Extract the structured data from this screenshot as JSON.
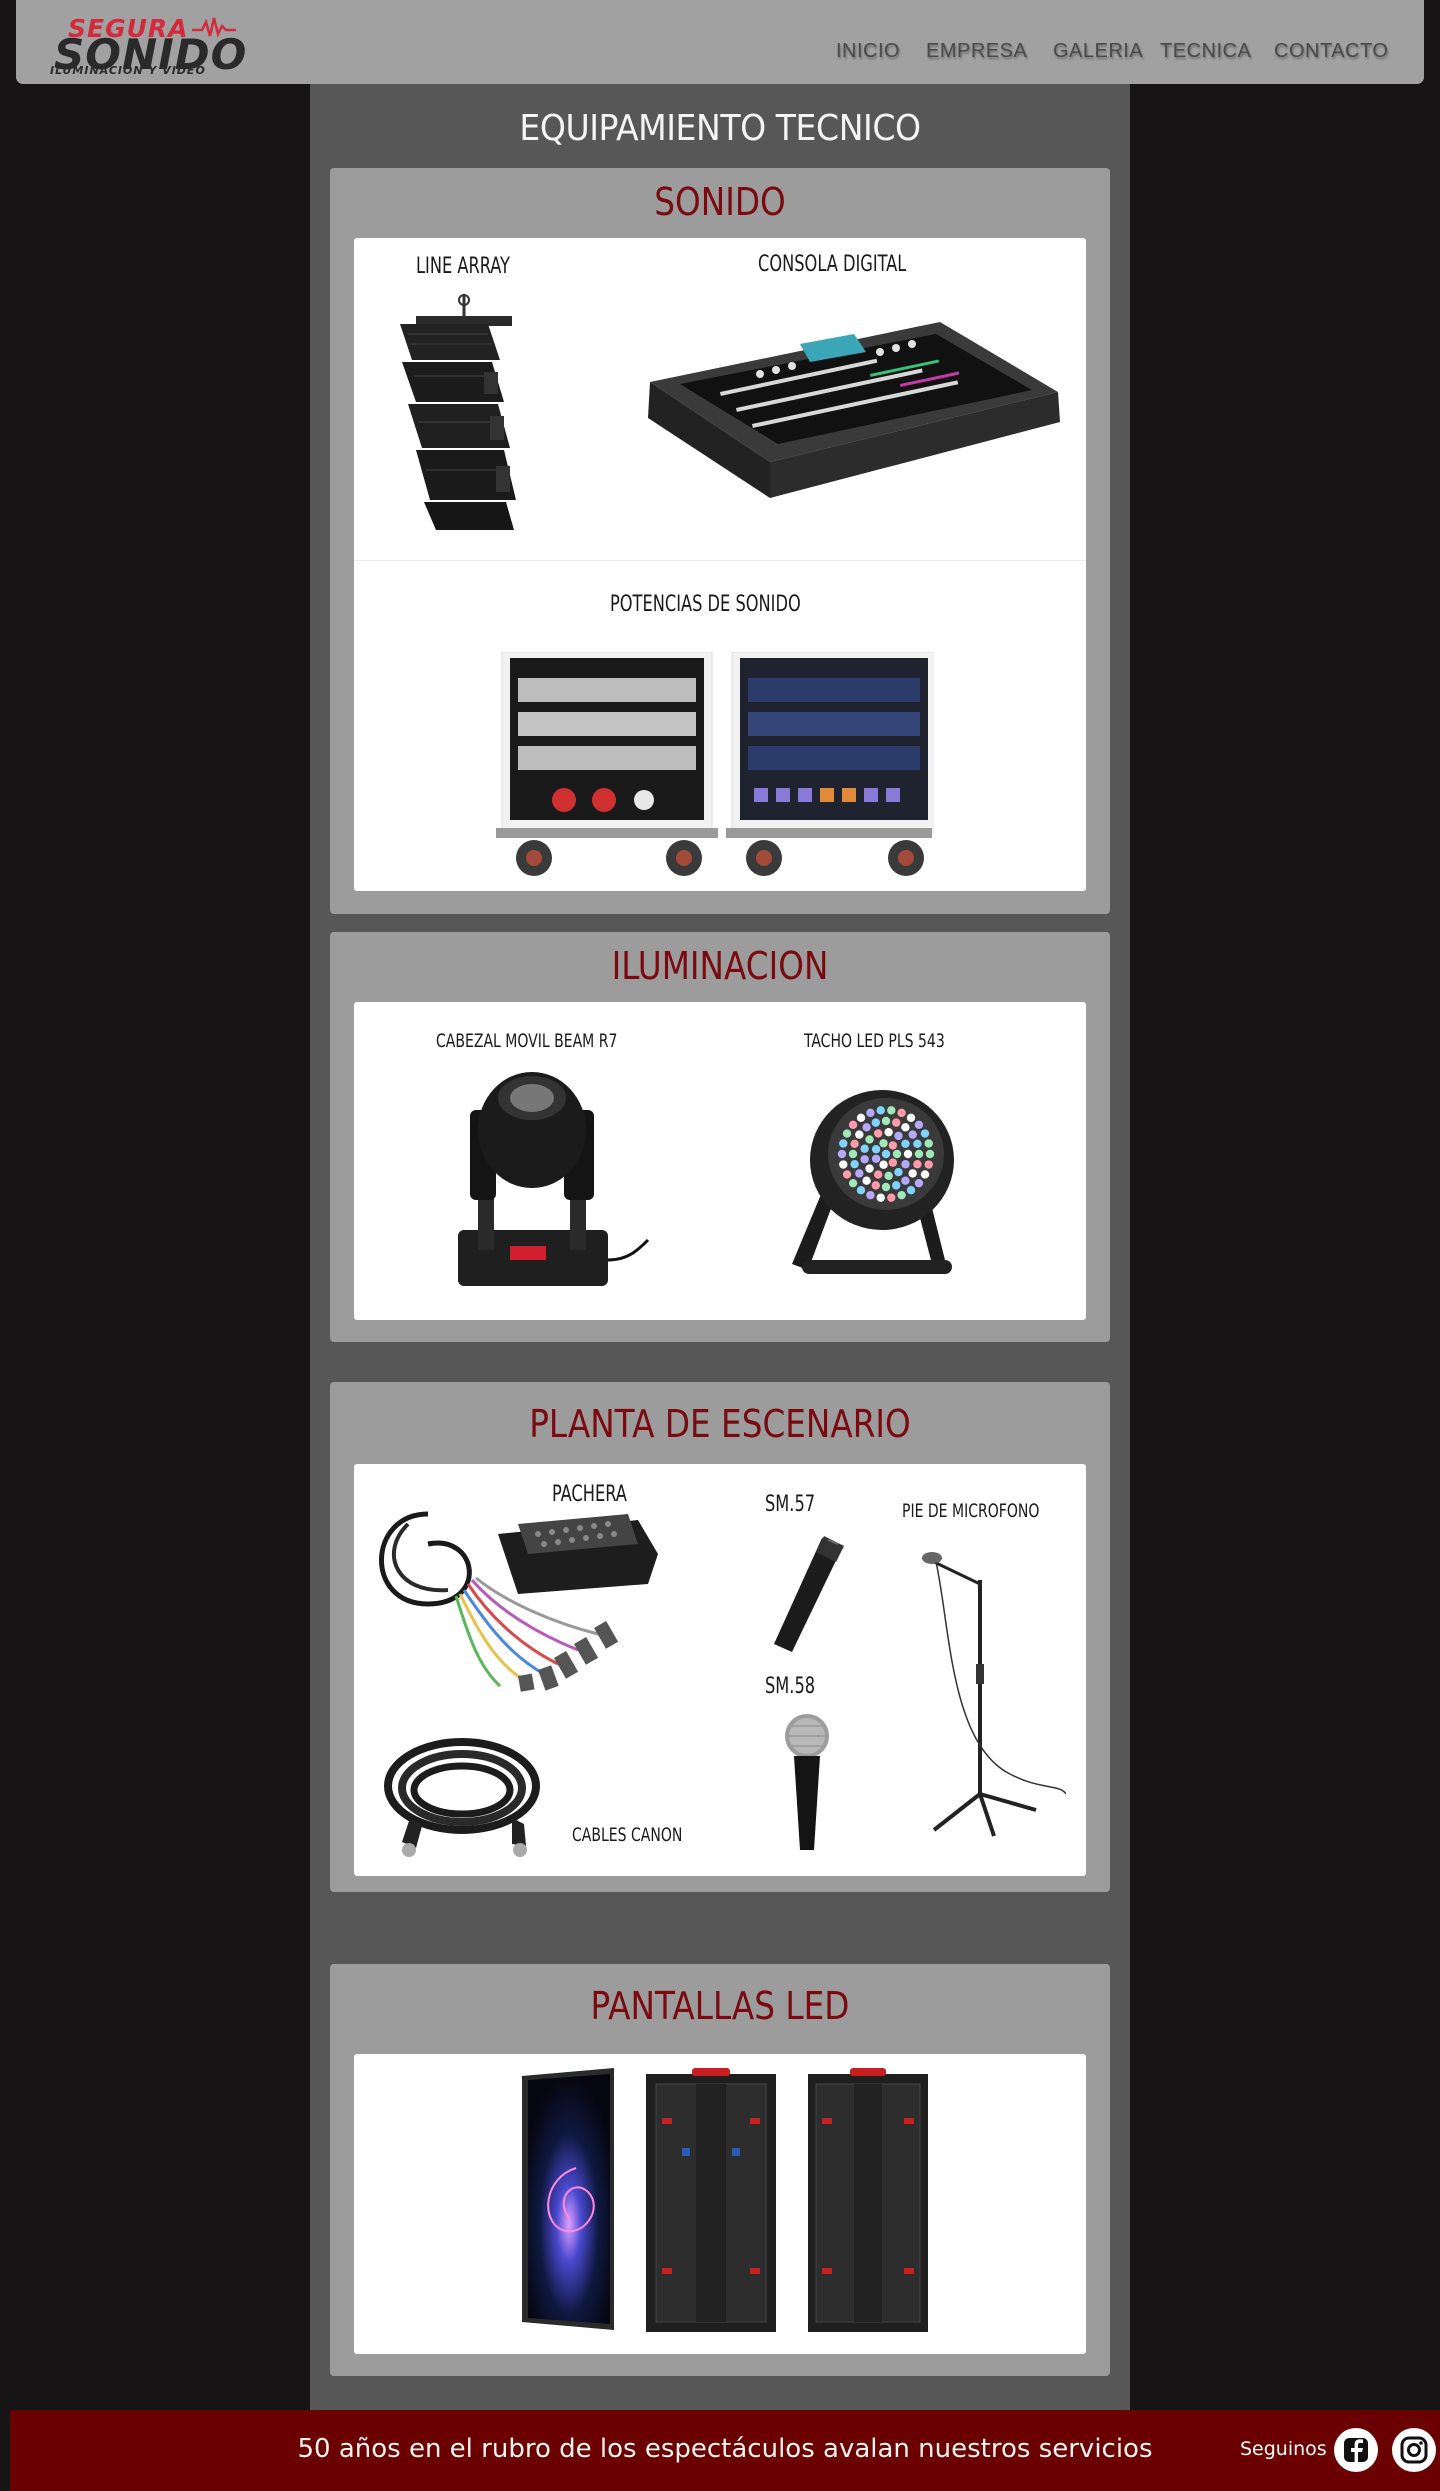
{
  "brand": {
    "logo_line1": "SEGURA",
    "logo_line2": "SONIDO",
    "logo_line3": "ILUMINACION Y VIDEO",
    "colors": {
      "accent": "#7a0a10",
      "logo_red": "#d42a3c",
      "footer": "#6b0000",
      "header": "#a1a1a1",
      "panel": "#9c9c9c",
      "column": "#575757",
      "background": "#161415"
    }
  },
  "nav": {
    "items": [
      {
        "label": "INICIO"
      },
      {
        "label": "EMPRESA"
      },
      {
        "label": "GALERIA"
      },
      {
        "label": "TECNICA"
      },
      {
        "label": "CONTACTO"
      }
    ]
  },
  "page": {
    "title": "EQUIPAMIENTO TECNICO"
  },
  "sections": {
    "sonido": {
      "title": "SONIDO",
      "items": {
        "line_array": "LINE ARRAY",
        "consola": "CONSOLA DIGITAL",
        "potencias": "POTENCIAS DE SONIDO"
      }
    },
    "iluminacion": {
      "title": "ILUMINACION",
      "items": {
        "cabezal": "CABEZAL MOVIL BEAM R7",
        "tacho": "TACHO LED PLS 543"
      }
    },
    "planta": {
      "title": "PLANTA DE ESCENARIO",
      "items": {
        "pachera": "PACHERA",
        "sm57": "SM.57",
        "pie": "PIE DE MICROFONO",
        "sm58": "SM.58",
        "cables": "CABLES CANON"
      }
    },
    "pantallas": {
      "title": "PANTALLAS LED"
    }
  },
  "footer": {
    "text": "50 años en el rubro de los espectáculos avalan nuestros servicios",
    "follow": "Seguinos",
    "icons": [
      "facebook-icon",
      "instagram-icon"
    ]
  }
}
